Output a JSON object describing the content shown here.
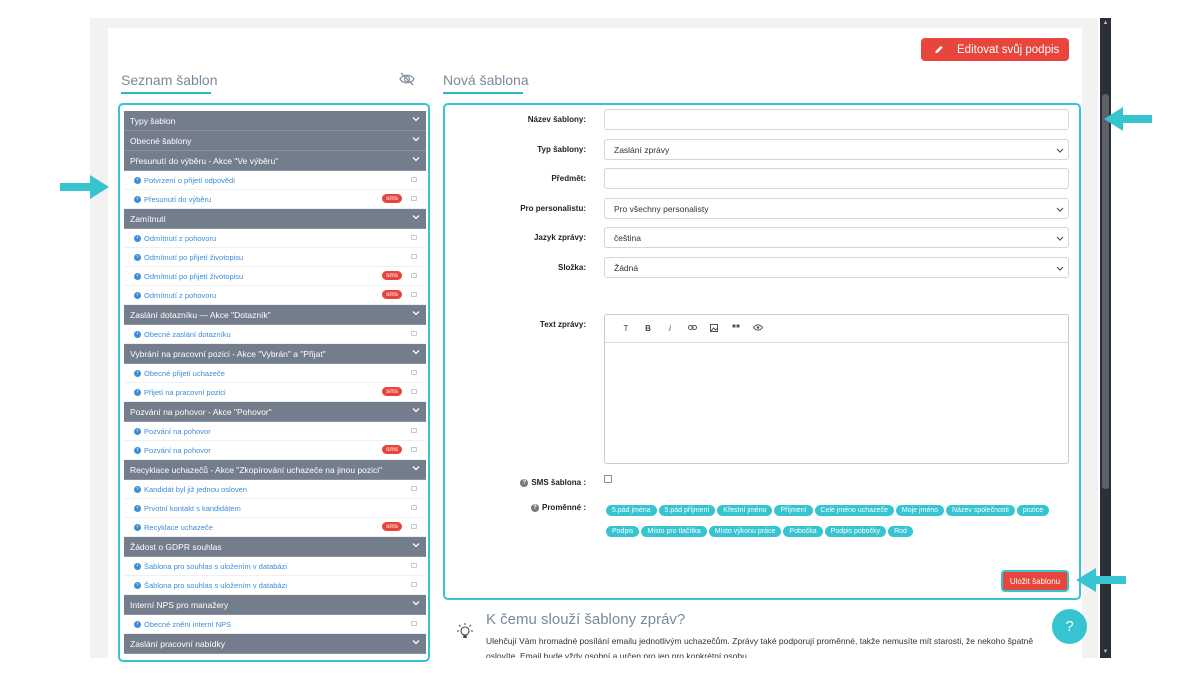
{
  "colors": {
    "accent": "#36c4d1",
    "danger": "#e8453c",
    "category": "#747d8c",
    "link": "#3b8ed8"
  },
  "header": {
    "edit_signature": "Editovat svůj podpis",
    "pencil_icon": "pencil-icon"
  },
  "left": {
    "title": "Seznam šablon",
    "visibility_icon": "eye-off-icon"
  },
  "right": {
    "title": "Nová šablona"
  },
  "template_list": [
    {
      "type": "category",
      "label": "Typy šablon"
    },
    {
      "type": "category",
      "label": "Obecné šablony"
    },
    {
      "type": "category",
      "label": "Přesunutí do výběru - Akce \"Ve výběru\""
    },
    {
      "type": "item",
      "label": "Potvrzení o přijetí odpovědi",
      "sms": false
    },
    {
      "type": "item",
      "label": "Přesunutí do výběru",
      "sms": true
    },
    {
      "type": "category",
      "label": "Zamítnutí"
    },
    {
      "type": "item",
      "label": "Odmítnutí z pohovoru",
      "sms": false
    },
    {
      "type": "item",
      "label": "Odmítnutí po přijetí životopisu",
      "sms": false
    },
    {
      "type": "item",
      "label": "Odmítnutí po přijetí životopisu",
      "sms": true
    },
    {
      "type": "item",
      "label": "Odmítnutí z pohovoru",
      "sms": true
    },
    {
      "type": "category",
      "label": "Zaslání dotazníku — Akce \"Dotazník\""
    },
    {
      "type": "item",
      "label": "Obecné zaslání dotazníku",
      "sms": false
    },
    {
      "type": "category",
      "label": "Vybrání na pracovní pozici - Akce \"Vybrán\" a \"Přijat\""
    },
    {
      "type": "item",
      "label": "Obecné přijetí uchazeče",
      "sms": false
    },
    {
      "type": "item",
      "label": "Přijetí na pracovní pozici",
      "sms": true
    },
    {
      "type": "category",
      "label": "Pozvání na pohovor - Akce \"Pohovor\""
    },
    {
      "type": "item",
      "label": "Pozvání na pohovor",
      "sms": false
    },
    {
      "type": "item",
      "label": "Pozvání na pohovor",
      "sms": true
    },
    {
      "type": "category",
      "label": "Recyklace uchazečů - Akce \"Zkopírování uchazeče na jinou pozici\""
    },
    {
      "type": "item",
      "label": "Kandidát byl již jednou osloven",
      "sms": false
    },
    {
      "type": "item",
      "label": "Prvotní kontakt s kandidátem",
      "sms": false
    },
    {
      "type": "item",
      "label": "Recyklace uchazeče",
      "sms": true
    },
    {
      "type": "category",
      "label": "Žádost o GDPR souhlas"
    },
    {
      "type": "item",
      "label": "Šablona pro souhlas s uložením v databázi",
      "sms": false
    },
    {
      "type": "item",
      "label": "Šablona pro souhlas s uložením v databázi",
      "sms": false
    },
    {
      "type": "category",
      "label": "Interní NPS pro manažery"
    },
    {
      "type": "item",
      "label": "Obecné znění interní NPS",
      "sms": false
    },
    {
      "type": "category",
      "label": "Zaslání pracovní nabídky"
    }
  ],
  "sms_badge": "sms",
  "form": {
    "name_label": "Název šablony:",
    "name_value": "",
    "type_label": "Typ šablony:",
    "type_value": "Zaslání zprávy",
    "subject_label": "Předmět:",
    "subject_value": "",
    "recruiter_label": "Pro personalistu:",
    "recruiter_value": "Pro všechny personalisty",
    "language_label": "Jazyk zprávy:",
    "language_value": "čeština",
    "folder_label": "Složka:",
    "folder_value": "Žádná",
    "text_label": "Text zprávy:",
    "toolbar": [
      "T",
      "B",
      "i",
      "link-icon",
      "image-icon",
      "quote-icon",
      "preview-icon"
    ],
    "sms_label": "SMS šablona :",
    "vars_label": "Proměnné :",
    "variables": [
      "5.pád jména",
      "5.pád příjmení",
      "Křestní jméno",
      "Příjmení",
      "Celé jméno uchazeče",
      "Moje jméno",
      "Název společnosti",
      "pozice",
      "Podpis",
      "Místo pro tlačítka",
      "Místo výkonu práce",
      "Pobočka",
      "Podpis pobočky",
      "Rod"
    ],
    "save": "Uložit šablonu"
  },
  "info": {
    "title": "K čemu slouží šablony zpráv?",
    "text": "Ulehčují Vám hromadné posílání emailu jednotlivým uchazečům. Zprávy také podporují proměnné, takže nemusíte mít starosti, že nekoho špatně oslovíte. Email bude vždy osobní a určen pro jen pro konkrétní osobu."
  },
  "help": "?"
}
